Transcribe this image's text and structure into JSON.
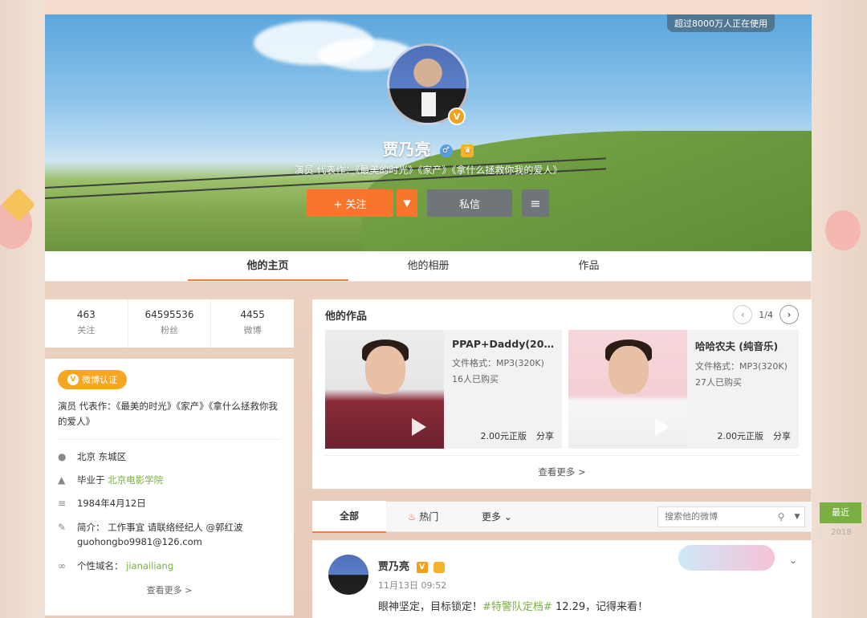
{
  "cover": {
    "users_badge": "超过8000万人正在使用",
    "name": "贾乃亮",
    "intro": "演员 代表作：《最美的时光》《家产》《拿什么拯救你我的爱人》",
    "follow_label": "+ 关注",
    "message_label": "私信"
  },
  "tabs": [
    {
      "label": "他的主页"
    },
    {
      "label": "他的相册"
    },
    {
      "label": "作品"
    }
  ],
  "counts": [
    {
      "num": "463",
      "label": "关注"
    },
    {
      "num": "64595536",
      "label": "粉丝"
    },
    {
      "num": "4455",
      "label": "微博"
    }
  ],
  "info": {
    "verified_tag": "微博认证",
    "bio": "演员 代表作：《最美的时光》《家产》《拿什么拯救你我的爱人》",
    "location": "北京 东城区",
    "school_prefix": "毕业于",
    "school": "北京电影学院",
    "birthday": "1984年4月12日",
    "brief": "简介： 工作事宜 请联络经纪人 @郭红波 guohongbo9981@126.com",
    "domain_prefix": "个性域名：",
    "domain": "jianailiang",
    "more": "查看更多 >"
  },
  "works": {
    "title": "他的作品",
    "page": "1/4",
    "items": [
      {
        "title": "PPAP+Daddy(20…",
        "format": "文件格式：MP3(320K)",
        "sold": "16人已购买",
        "price": "2.00元正版",
        "share": "分享"
      },
      {
        "title": "哈哈农夫 (纯音乐)",
        "format": "文件格式：MP3(320K)",
        "sold": "27人已购买",
        "price": "2.00元正版",
        "share": "分享"
      }
    ],
    "see_more": "查看更多 >"
  },
  "feed": {
    "tab_all": "全部",
    "tab_hot": "热门",
    "tab_more": "更多",
    "search_placeholder": "搜索他的微博"
  },
  "post": {
    "name": "贾乃亮",
    "time": "11月13日 09:52",
    "text_before": "眼神坚定，目标锁定！",
    "tag": "#特警队定档#",
    "text_after": " 12.29，记得来看！"
  },
  "year_nav": {
    "recent": "最近",
    "year": "2018"
  }
}
